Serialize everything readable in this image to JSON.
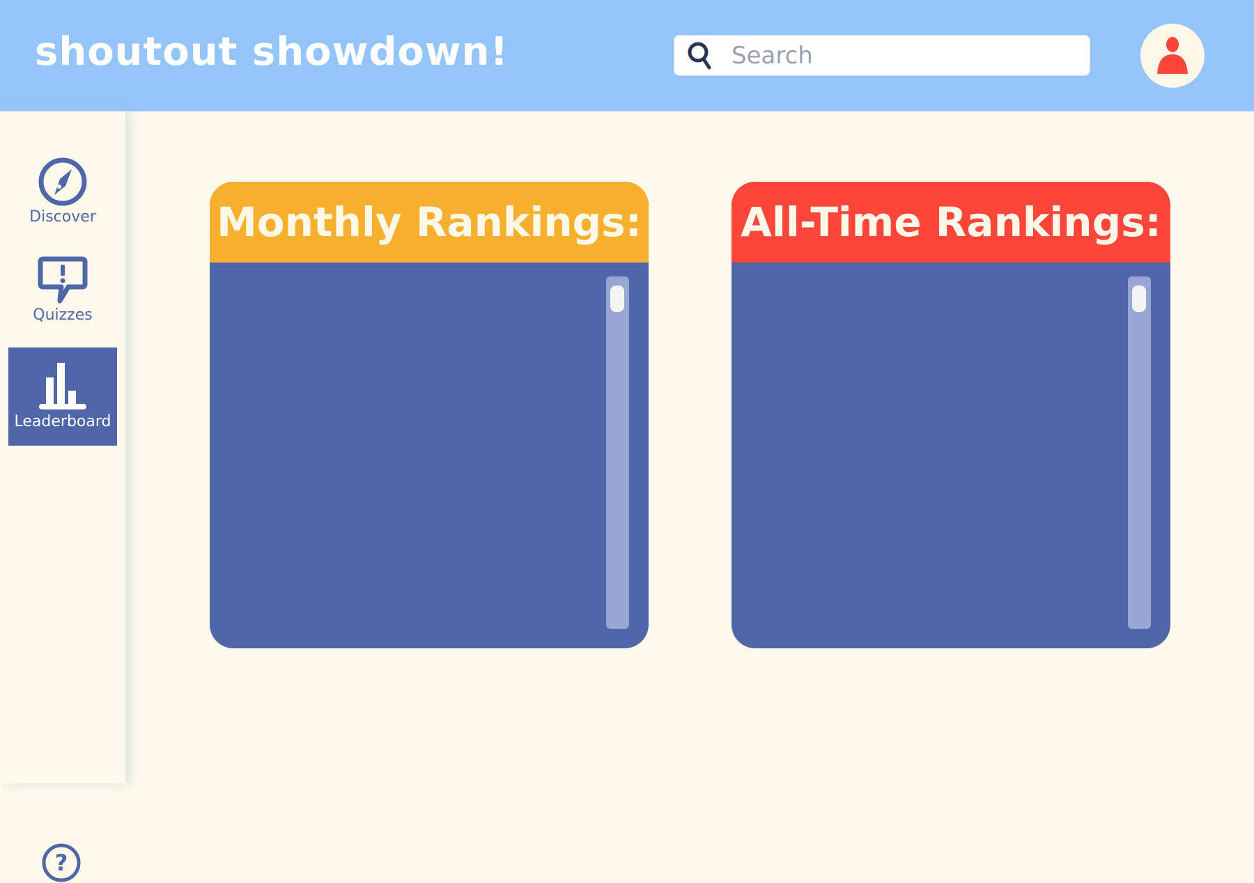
{
  "header": {
    "title": "shoutout showdown!",
    "search_placeholder": "Search"
  },
  "sidebar": {
    "items": [
      {
        "label": "Discover",
        "icon": "compass-icon"
      },
      {
        "label": "Quizzes",
        "icon": "speech-bubble-exclamation-icon"
      },
      {
        "label": "Leaderboard",
        "icon": "bar-chart-icon",
        "active": true
      }
    ],
    "help_icon": "help-icon"
  },
  "cards": [
    {
      "title": "Monthly Rankings:",
      "color": "#f7b02e"
    },
    {
      "title": "All-Time Rankings:",
      "color": "#fe453a"
    }
  ],
  "colors": {
    "header": "#93c5fb",
    "accent": "#4f67a9",
    "background": "#fef9ea"
  }
}
